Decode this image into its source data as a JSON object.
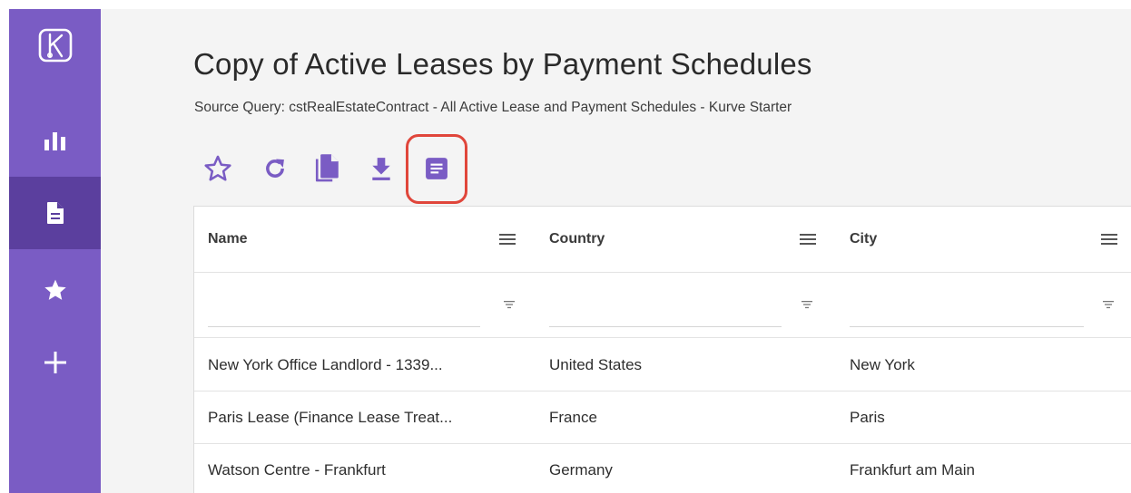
{
  "sidebar": {
    "items": [
      {
        "name": "logo",
        "icon": "kurve-logo-icon"
      },
      {
        "name": "analytics",
        "icon": "bar-chart-icon"
      },
      {
        "name": "reports",
        "icon": "document-icon",
        "active": true
      },
      {
        "name": "favorites",
        "icon": "star-icon"
      },
      {
        "name": "create",
        "icon": "plus-icon"
      }
    ],
    "colors": {
      "background": "#7a5cc4",
      "active": "#5b3f9e"
    }
  },
  "header": {
    "title": "Copy of Active Leases by Payment Schedules",
    "subtitle": "Source Query: cstRealEstateContract - All Active Lease and Payment Schedules - Kurve Starter"
  },
  "toolbar": {
    "buttons": [
      {
        "name": "favorite",
        "icon": "star-outline-icon"
      },
      {
        "name": "refresh",
        "icon": "refresh-icon"
      },
      {
        "name": "copy",
        "icon": "copy-icon"
      },
      {
        "name": "download",
        "icon": "download-icon"
      },
      {
        "name": "report",
        "icon": "report-icon",
        "highlighted": true
      }
    ],
    "accent": "#7a5cc4",
    "highlight_color": "#e0463b"
  },
  "grid": {
    "columns": [
      "Name",
      "Country",
      "City"
    ],
    "rows": [
      [
        "New York Office Landlord - 1339...",
        "United States",
        "New York"
      ],
      [
        "Paris Lease (Finance Lease Treat...",
        "France",
        "Paris"
      ],
      [
        "Watson Centre - Frankfurt",
        "Germany",
        "Frankfurt am Main"
      ]
    ]
  }
}
